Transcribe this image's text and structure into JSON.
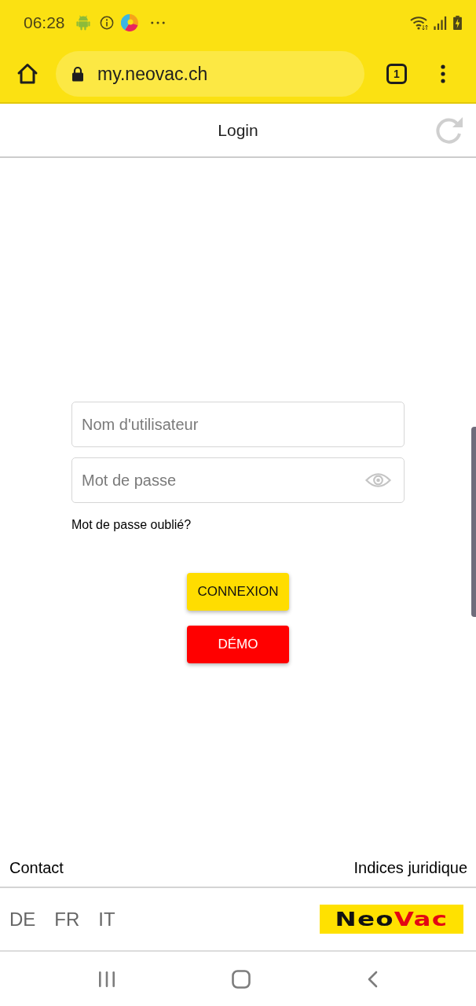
{
  "status_bar": {
    "time": "06:28"
  },
  "browser": {
    "url": "my.neovac.ch",
    "tab_count": "1"
  },
  "header": {
    "title": "Login"
  },
  "login_form": {
    "username": {
      "placeholder": "Nom d'utilisateur"
    },
    "password": {
      "placeholder": "Mot de passe"
    },
    "forgot_link": "Mot de passe oublié?",
    "buttons": [
      {
        "kind": "primary",
        "label": "CONNEXION"
      },
      {
        "kind": "danger",
        "label": "DÉMO"
      }
    ]
  },
  "footer": {
    "links": [
      "Contact",
      "Indices juridique"
    ],
    "languages": [
      "DE",
      "FR",
      "IT"
    ],
    "logo": {
      "parts": [
        "Neo",
        "Vac"
      ]
    }
  }
}
